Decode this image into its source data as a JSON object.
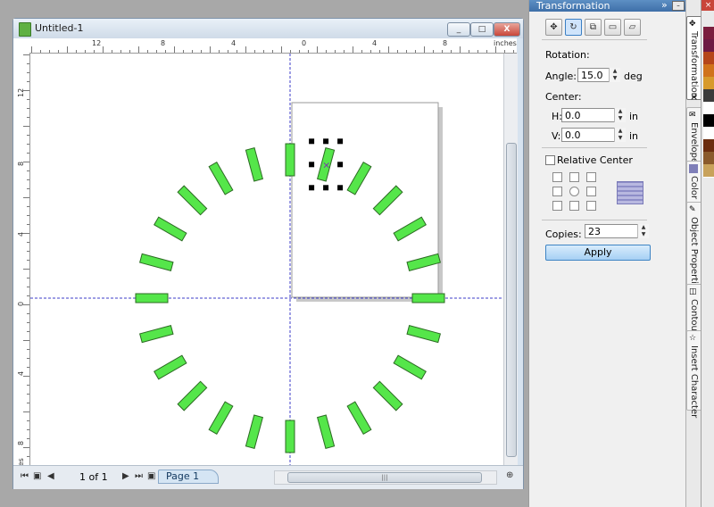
{
  "document": {
    "title": "Untitled-1",
    "ruler_unit": "inches",
    "h_ruler_labels": [
      "12",
      "8",
      "4",
      "0",
      "4",
      "8"
    ],
    "v_ruler_labels": [
      "12",
      "8",
      "4",
      "0",
      "4",
      "8"
    ],
    "page_count": "1 of 1",
    "page_tab": "Page 1",
    "window_buttons": {
      "minimize": "_",
      "maximize": "□",
      "close": "X"
    }
  },
  "docker": {
    "title": "Transformation",
    "rotation_label": "Rotation:",
    "angle_label": "Angle:",
    "angle_value": "15.0",
    "angle_unit": "deg",
    "center_label": "Center:",
    "h_label": "H:",
    "h_value": "0.0",
    "h_unit": "in",
    "v_label": "V:",
    "v_value": "0.0",
    "v_unit": "in",
    "relative_center_label": "Relative Center",
    "copies_label": "Copies:",
    "copies_value": "23",
    "apply_label": "Apply",
    "mode_icons": [
      "position-icon",
      "rotate-icon",
      "scale-mirror-icon",
      "size-icon",
      "skew-icon"
    ]
  },
  "tabs": [
    {
      "label": "Transformation",
      "active": true
    },
    {
      "label": "Envelope",
      "active": false
    },
    {
      "label": "Color",
      "active": false
    },
    {
      "label": "Object Properties",
      "active": false
    },
    {
      "label": "Contour",
      "active": false
    },
    {
      "label": "Insert Character",
      "active": false
    }
  ],
  "palette": [
    "#7b1e3e",
    "#6e1a44",
    "#b5461a",
    "#d0731b",
    "#d79a2c",
    "#3b3b3b",
    "#ffffff",
    "#000000",
    "#ffffff",
    "#6b2d0f",
    "#8a5a2b",
    "#c8a25b"
  ],
  "artwork": {
    "shape_color": "#55e64a",
    "shape_count": 24,
    "step_degrees": 15
  }
}
